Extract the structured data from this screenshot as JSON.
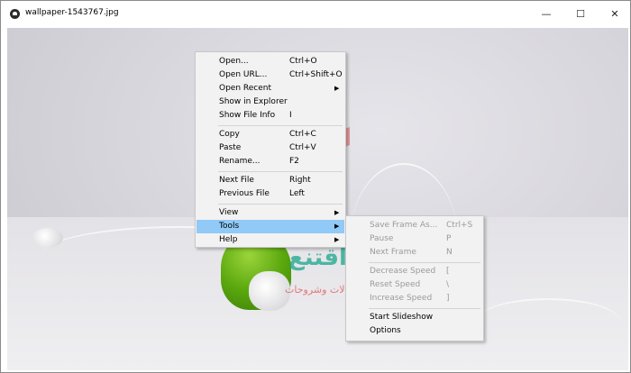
{
  "window": {
    "title": "wallpaper-1543767.jpg"
  },
  "controls": {
    "minimize": "—",
    "maximize": "☐",
    "close": "✕"
  },
  "watermark": {
    "text": "اقتنع",
    "subtitle": "مقالات وشروحات"
  },
  "context_menu": {
    "items": [
      {
        "label": "Open...",
        "shortcut": "Ctrl+O"
      },
      {
        "label": "Open URL...",
        "shortcut": "Ctrl+Shift+O"
      },
      {
        "label": "Open Recent",
        "arrow": "▶"
      },
      {
        "label": "Show in Explorer"
      },
      {
        "label": "Show File Info",
        "shortcut": "I"
      },
      {
        "label": "Copy",
        "shortcut": "Ctrl+C"
      },
      {
        "label": "Paste",
        "shortcut": "Ctrl+V"
      },
      {
        "label": "Rename...",
        "shortcut": "F2"
      },
      {
        "label": "Next File",
        "shortcut": "Right"
      },
      {
        "label": "Previous File",
        "shortcut": "Left"
      },
      {
        "label": "View",
        "arrow": "▶"
      },
      {
        "label": "Tools",
        "arrow": "▶",
        "highlighted": true
      },
      {
        "label": "Help",
        "arrow": "▶"
      }
    ]
  },
  "tools_submenu": {
    "items": [
      {
        "label": "Save Frame As...",
        "shortcut": "Ctrl+S",
        "disabled": true
      },
      {
        "label": "Pause",
        "shortcut": "P",
        "disabled": true
      },
      {
        "label": "Next Frame",
        "shortcut": "N",
        "disabled": true
      },
      {
        "label": "Decrease Speed",
        "shortcut": "[",
        "disabled": true
      },
      {
        "label": "Reset Speed",
        "shortcut": "\\",
        "disabled": true
      },
      {
        "label": "Increase Speed",
        "shortcut": "]",
        "disabled": true
      },
      {
        "label": "Start Slideshow"
      },
      {
        "label": "Options"
      }
    ]
  }
}
